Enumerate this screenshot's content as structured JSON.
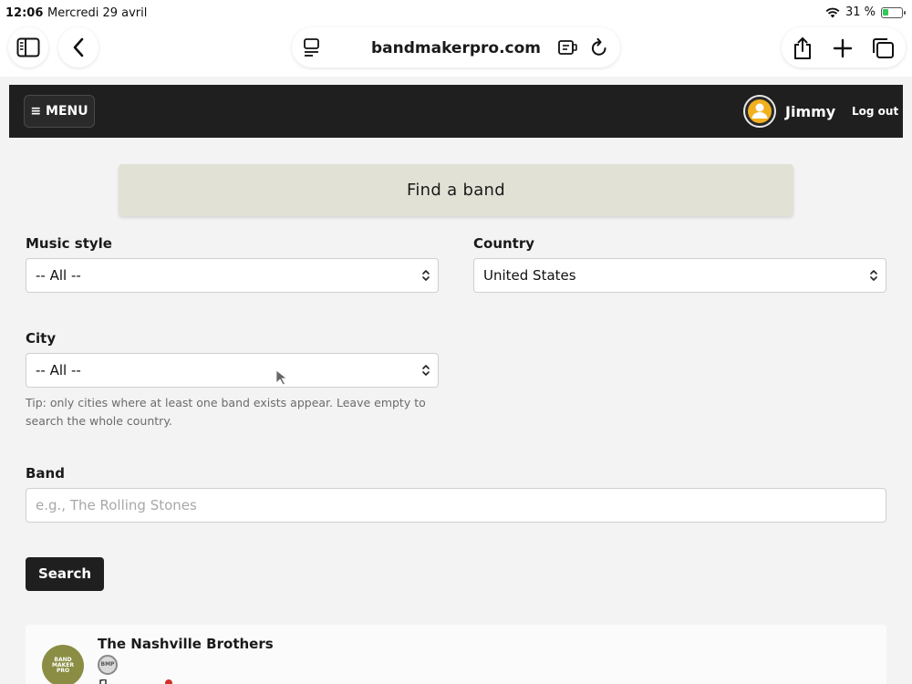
{
  "status": {
    "time": "12:06",
    "date": "Mercredi 29 avril",
    "battery": "31 %",
    "battery_level": 0.31
  },
  "browser": {
    "url": "bandmakerpro.com"
  },
  "header": {
    "menu_label": "≡ MENU",
    "user_name": "Jimmy",
    "logout_label": "Log out"
  },
  "page": {
    "title": "Find a band"
  },
  "filters": {
    "music_style": {
      "label": "Music style",
      "value": "-- All --"
    },
    "country": {
      "label": "Country",
      "value": "United States"
    },
    "city": {
      "label": "City",
      "value": "-- All --",
      "tip": "Tip: only cities where at least one band exists appear. Leave empty to search the whole country."
    },
    "band": {
      "label": "Band",
      "placeholder": "e.g., The Rolling Stones"
    },
    "search_label": "Search"
  },
  "results": [
    {
      "name": "The Nashville Brothers",
      "logo_text": "BAND MAKER PRO",
      "badge": "BMP"
    }
  ],
  "colors": {
    "header_bg": "#1f1f1f",
    "banner_bg": "#e1e2d5",
    "band_logo_bg": "#8a8d43",
    "battery_green": "#34c759"
  }
}
